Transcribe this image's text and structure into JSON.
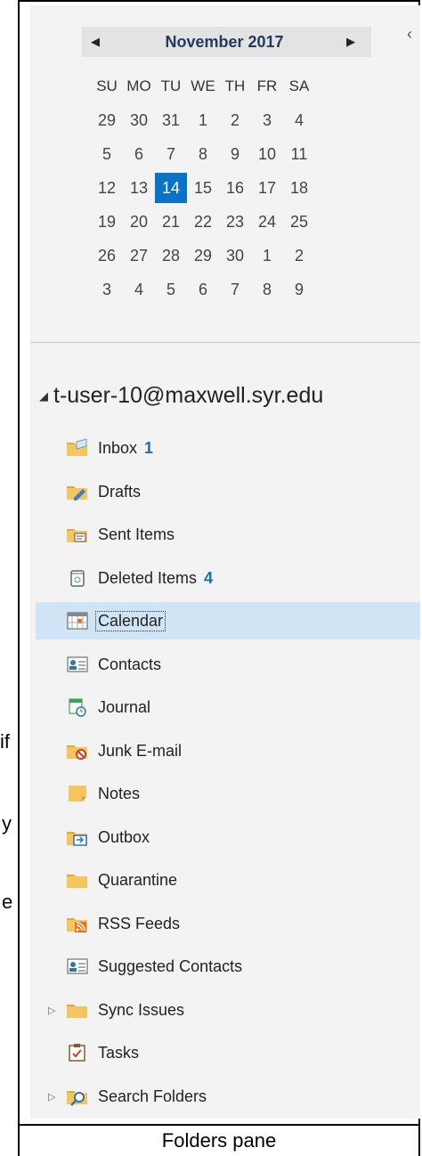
{
  "background_text": [
    "if",
    "y",
    "e"
  ],
  "frame_caption": "Folders pane",
  "calendar": {
    "month_label": "November 2017",
    "prev_label": "◀",
    "next_label": "▶",
    "days_of_week": [
      "SU",
      "MO",
      "TU",
      "WE",
      "TH",
      "FR",
      "SA"
    ],
    "weeks": [
      [
        "29",
        "30",
        "31",
        "1",
        "2",
        "3",
        "4"
      ],
      [
        "5",
        "6",
        "7",
        "8",
        "9",
        "10",
        "11"
      ],
      [
        "12",
        "13",
        "14",
        "15",
        "16",
        "17",
        "18"
      ],
      [
        "19",
        "20",
        "21",
        "22",
        "23",
        "24",
        "25"
      ],
      [
        "26",
        "27",
        "28",
        "29",
        "30",
        "1",
        "2"
      ],
      [
        "3",
        "4",
        "5",
        "6",
        "7",
        "8",
        "9"
      ]
    ],
    "today": "14"
  },
  "collapse_glyph": "‹",
  "account": {
    "label": "t-user-10@maxwell.syr.edu",
    "expander": "◢"
  },
  "folders": [
    {
      "label": "Inbox",
      "count": "1",
      "icon": "inbox-icon"
    },
    {
      "label": "Drafts",
      "count": "",
      "icon": "drafts-icon"
    },
    {
      "label": "Sent Items",
      "count": "",
      "icon": "sent-items-icon"
    },
    {
      "label": "Deleted Items",
      "count": "4",
      "icon": "trash-icon"
    },
    {
      "label": "Calendar",
      "count": "",
      "icon": "calendar-icon",
      "selected": true
    },
    {
      "label": "Contacts",
      "count": "",
      "icon": "contact-card-icon"
    },
    {
      "label": "Journal",
      "count": "",
      "icon": "journal-icon"
    },
    {
      "label": "Junk E-mail",
      "count": "",
      "icon": "junk-icon"
    },
    {
      "label": "Notes",
      "count": "",
      "icon": "notes-icon"
    },
    {
      "label": "Outbox",
      "count": "",
      "icon": "outbox-icon"
    },
    {
      "label": "Quarantine",
      "count": "",
      "icon": "folder-icon"
    },
    {
      "label": "RSS Feeds",
      "count": "",
      "icon": "rss-icon"
    },
    {
      "label": "Suggested Contacts",
      "count": "",
      "icon": "contact-card-icon"
    },
    {
      "label": "Sync Issues",
      "count": "",
      "icon": "folder-icon",
      "expander": "▷"
    },
    {
      "label": "Tasks",
      "count": "",
      "icon": "tasks-icon"
    },
    {
      "label": "Search Folders",
      "count": "",
      "icon": "search-folder-icon",
      "expander": "▷"
    }
  ],
  "colors": {
    "accent": "#0a73c8",
    "selection": "#cfe5f5",
    "count": "#1f6eb3",
    "folder": "#f5c55f"
  }
}
